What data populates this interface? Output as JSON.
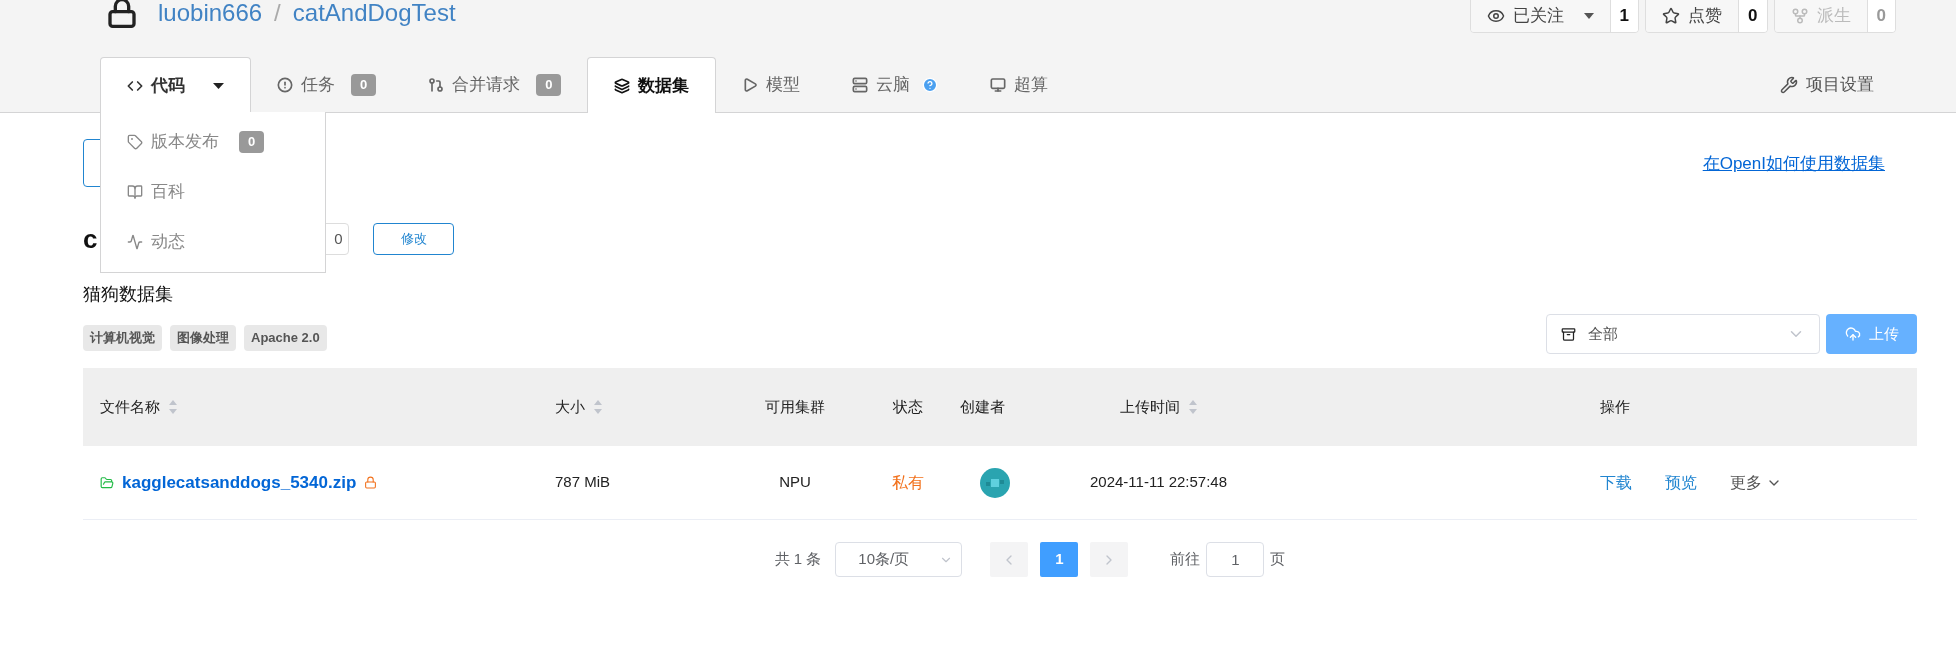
{
  "repo": {
    "owner": "luobin666",
    "separator": "/",
    "name": "catAndDogTest"
  },
  "repo_actions": [
    {
      "kind": "watch",
      "label": "已关注",
      "count": "1",
      "disabled": false
    },
    {
      "kind": "star",
      "label": "点赞",
      "count": "0",
      "disabled": false
    },
    {
      "kind": "fork",
      "label": "派生",
      "count": "0",
      "disabled": true
    }
  ],
  "tabs": [
    {
      "kind": "code",
      "label": "代码",
      "selected": false,
      "open": true
    },
    {
      "kind": "issues",
      "label": "任务",
      "badge": "0",
      "selected": false,
      "open": false
    },
    {
      "kind": "pulls",
      "label": "合并请求",
      "badge": "0",
      "selected": false,
      "open": false
    },
    {
      "kind": "datasets",
      "label": "数据集",
      "selected": true,
      "open": false
    },
    {
      "kind": "models",
      "label": "模型",
      "selected": false,
      "open": false
    },
    {
      "kind": "cloudbrain",
      "label": "云脑",
      "help": true,
      "selected": false,
      "open": false
    },
    {
      "kind": "supercompute",
      "label": "超算",
      "selected": false,
      "open": false
    }
  ],
  "settings": {
    "label": "项目设置"
  },
  "code_menu": [
    {
      "kind": "releases",
      "label": "版本发布",
      "badge": "0"
    },
    {
      "kind": "wiki",
      "label": "百科"
    },
    {
      "kind": "activity",
      "label": "动态"
    }
  ],
  "help_link": "在OpenI如何使用数据集",
  "dataset": {
    "title": "c",
    "count": "0",
    "edit_button": "修改",
    "description": "猫狗数据集",
    "tags": [
      "计算机视觉",
      "图像处理",
      "Apache 2.0"
    ]
  },
  "filter": {
    "value": "全部"
  },
  "upload_button": "上传",
  "table": {
    "columns": [
      {
        "label": "文件名称",
        "sortable": true
      },
      {
        "label": "大小",
        "sortable": true
      },
      {
        "label": "可用集群",
        "sortable": false
      },
      {
        "label": "状态",
        "sortable": false
      },
      {
        "label": "创建者",
        "sortable": false
      },
      {
        "label": "上传时间",
        "sortable": true
      },
      {
        "label": "操作",
        "sortable": false
      }
    ],
    "rows": [
      {
        "file": "kagglecatsanddogs_5340.zip",
        "locked": true,
        "size": "787 MiB",
        "cluster": "NPU",
        "status": "私有",
        "uploaded": "2024-11-11 22:57:48",
        "actions": [
          "下载",
          "预览"
        ],
        "more": "更多"
      }
    ]
  },
  "pagination": {
    "total": "共 1 条",
    "page_size": "10条/页",
    "pages": [
      {
        "label": "1",
        "selected": true
      }
    ],
    "goto_label": "前往",
    "goto_value": "1",
    "goto_suffix": "页"
  }
}
